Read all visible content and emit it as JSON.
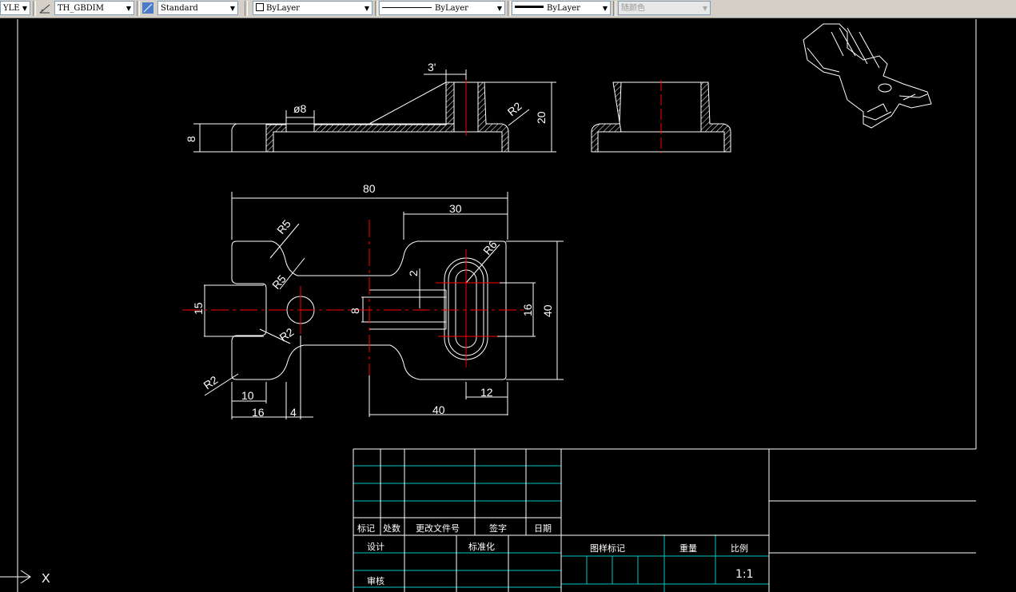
{
  "toolbar": {
    "style_combo": "YLE",
    "dimstyle_combo": "TH_GBDIM",
    "tablestyle_combo": "Standard",
    "layer_color_combo": "ByLayer",
    "linetype_combo": "ByLayer",
    "lineweight_combo": "ByLayer",
    "plotstyle_combo": "随颜色"
  },
  "drawing": {
    "side_view": {
      "dim_3": "3'",
      "dim_phi8": "ø8",
      "dim_8": "8",
      "dim_20": "20",
      "dim_r2": "R2"
    },
    "top_view": {
      "dim_80": "80",
      "dim_30": "30",
      "dim_r5a": "R5",
      "dim_r5b": "R5",
      "dim_r6": "R6",
      "dim_2": "2",
      "dim_15": "15",
      "dim_8": "8",
      "dim_16": "16",
      "dim_40v": "40",
      "dim_r2a": "R2",
      "dim_r2b": "R2",
      "dim_10": "10",
      "dim_16h": "16",
      "dim_4": "4",
      "dim_12": "12",
      "dim_40h": "40"
    },
    "ucs_label": "X"
  },
  "title_block": {
    "mark": "标记",
    "count": "处数",
    "change_doc": "更改文件号",
    "signature": "签字",
    "date": "日期",
    "design": "设计",
    "standardize": "标准化",
    "review": "审核",
    "drawing_mark": "图样标记",
    "weight": "重量",
    "scale": "比例",
    "scale_value": "1:1"
  },
  "colors": {
    "background": "#000000",
    "lines": "#ffffff",
    "centerline": "#ff0000",
    "table_lines": "#00c8c8",
    "toolbar": "#d4d0c8"
  }
}
